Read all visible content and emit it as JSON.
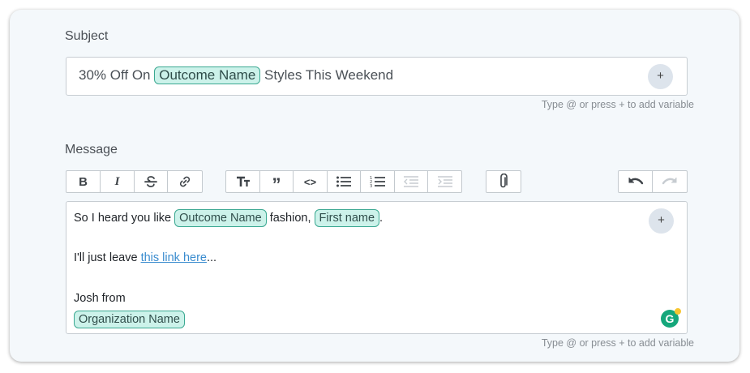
{
  "subject": {
    "label": "Subject",
    "prefix": "30% Off On",
    "variable": "Outcome Name",
    "suffix": "Styles This Weekend",
    "add_button": "+",
    "hint": "Type @ or press + to add variable"
  },
  "message": {
    "label": "Message",
    "line1_pre": "So I heard you like",
    "line1_var1": "Outcome Name",
    "line1_mid": "fashion,",
    "line1_var2": "First name",
    "line1_post": ".",
    "line2_pre": "I'll just leave",
    "line2_link": "this link here",
    "line2_post": "...",
    "line3": "Josh from",
    "line4_var": "Organization Name",
    "add_button": "+",
    "hint": "Type @ or press + to add variable",
    "grammarly_letter": "G"
  },
  "toolbar": {
    "bold": "B",
    "italic": "I",
    "quote": "”",
    "code": "<>"
  },
  "colors": {
    "chip_bg": "#ccf2ea",
    "chip_border": "#3aa891",
    "link": "#3a8ccf",
    "grammarly": "#15a77b"
  }
}
